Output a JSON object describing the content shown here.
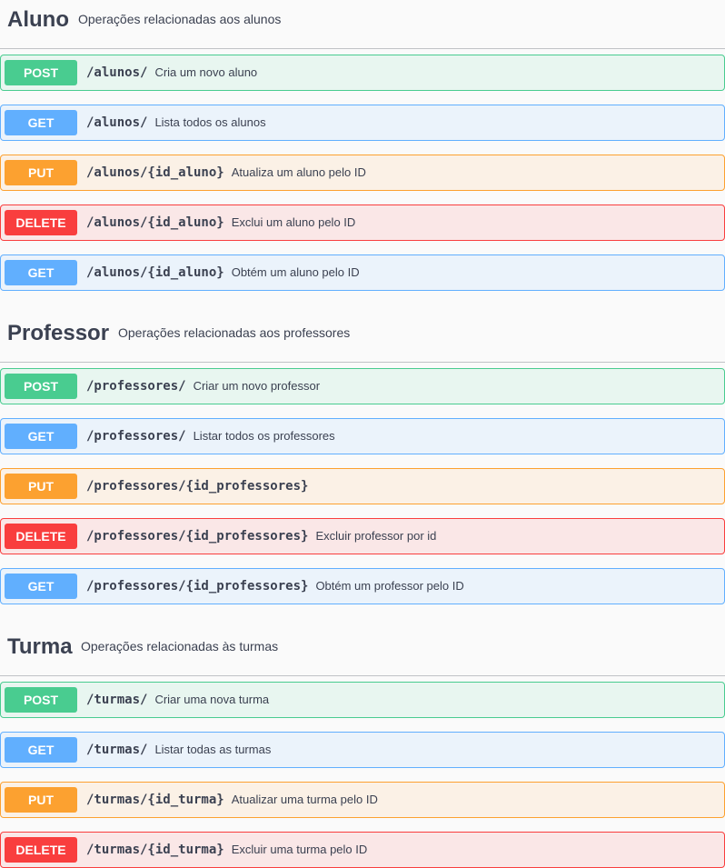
{
  "colors": {
    "post": "#49cc90",
    "get": "#61affe",
    "put": "#fca130",
    "delete": "#f93e3e",
    "text": "#3b4151"
  },
  "sections": [
    {
      "name": "Aluno",
      "description": "Operações relacionadas aos alunos",
      "operations": [
        {
          "method": "POST",
          "path": "/alunos/",
          "summary": "Cria um novo aluno"
        },
        {
          "method": "GET",
          "path": "/alunos/",
          "summary": "Lista todos os alunos"
        },
        {
          "method": "PUT",
          "path": "/alunos/{id_aluno}",
          "summary": "Atualiza um aluno pelo ID"
        },
        {
          "method": "DELETE",
          "path": "/alunos/{id_aluno}",
          "summary": "Exclui um aluno pelo ID"
        },
        {
          "method": "GET",
          "path": "/alunos/{id_aluno}",
          "summary": "Obtém um aluno pelo ID"
        }
      ]
    },
    {
      "name": "Professor",
      "description": "Operações relacionadas aos professores",
      "operations": [
        {
          "method": "POST",
          "path": "/professores/",
          "summary": "Criar um novo professor"
        },
        {
          "method": "GET",
          "path": "/professores/",
          "summary": "Listar todos os professores"
        },
        {
          "method": "PUT",
          "path": "/professores/{id_professores}",
          "summary": ""
        },
        {
          "method": "DELETE",
          "path": "/professores/{id_professores}",
          "summary": "Excluir professor por id"
        },
        {
          "method": "GET",
          "path": "/professores/{id_professores}",
          "summary": "Obtém um professor pelo ID"
        }
      ]
    },
    {
      "name": "Turma",
      "description": "Operações relacionadas às turmas",
      "operations": [
        {
          "method": "POST",
          "path": "/turmas/",
          "summary": "Criar uma nova turma"
        },
        {
          "method": "GET",
          "path": "/turmas/",
          "summary": "Listar todas as turmas"
        },
        {
          "method": "PUT",
          "path": "/turmas/{id_turma}",
          "summary": "Atualizar uma turma pelo ID"
        },
        {
          "method": "DELETE",
          "path": "/turmas/{id_turma}",
          "summary": "Excluir uma turma pelo ID"
        }
      ]
    }
  ]
}
